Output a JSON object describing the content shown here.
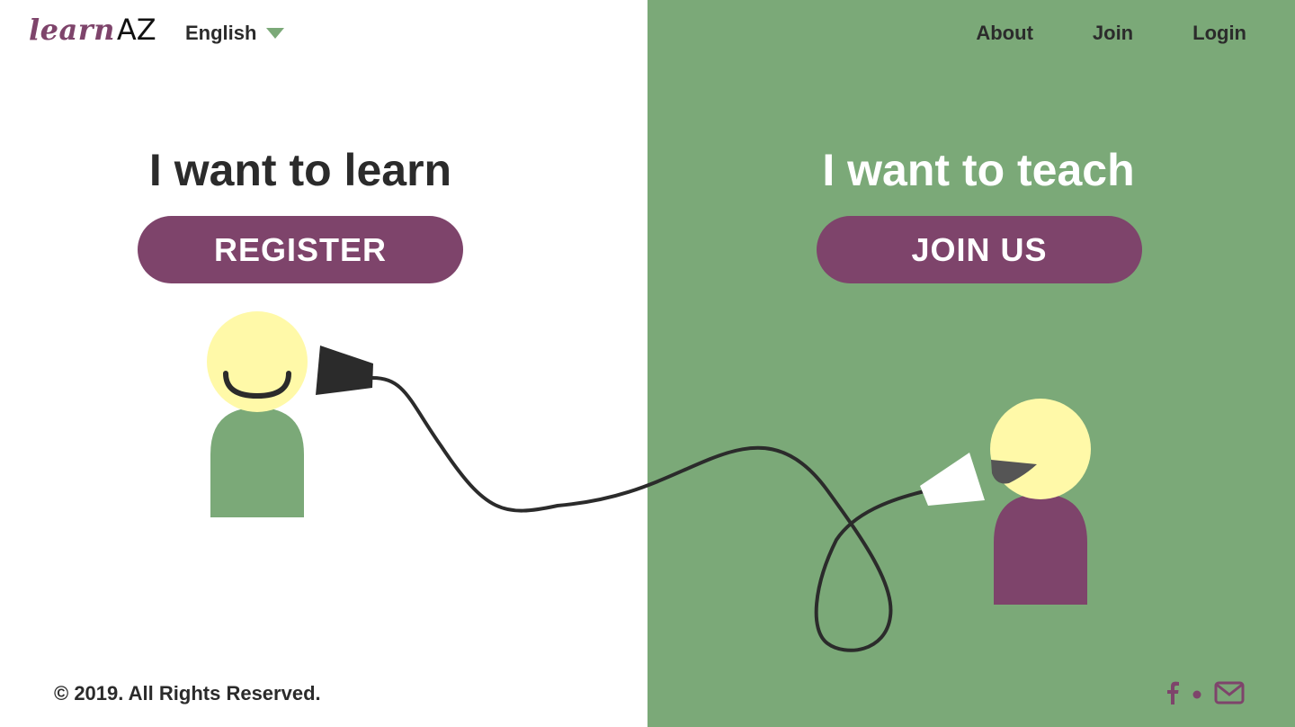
{
  "brand": {
    "logo_part1": "learn",
    "logo_part2": "AZ"
  },
  "language": {
    "selected": "English"
  },
  "nav": {
    "about": "About",
    "join": "Join",
    "login": "Login"
  },
  "learner": {
    "heading": "I want to learn",
    "button": "REGISTER"
  },
  "teacher": {
    "heading": "I want to teach",
    "button": "JOIN US"
  },
  "footer": {
    "copyright": "© 2019. All Rights Reserved."
  },
  "social": {
    "icons": [
      "facebook-icon",
      "dot-separator",
      "mail-icon"
    ]
  },
  "colors": {
    "green": "#7ba978",
    "purple": "#7e446b",
    "dark": "#2b2b2b",
    "skin": "#fff9a8",
    "white": "#ffffff"
  }
}
